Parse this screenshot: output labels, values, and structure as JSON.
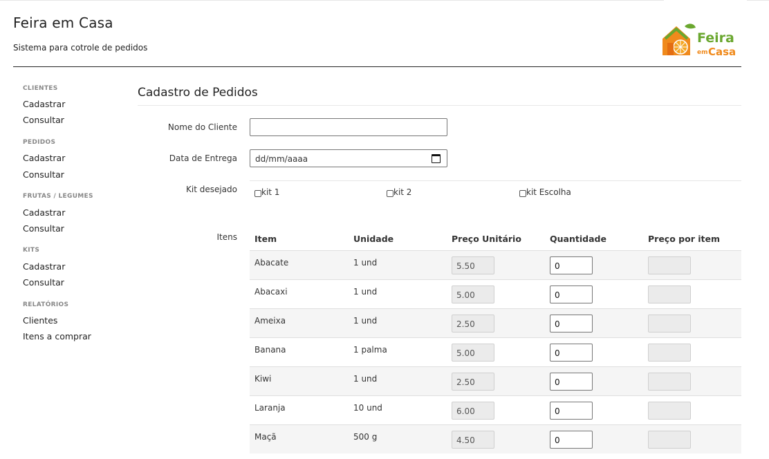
{
  "header": {
    "title": "Feira em Casa",
    "subtitle": "Sistema para cotrole de pedidos",
    "logo_text": "Feira em Casa"
  },
  "sidebar": {
    "sections": [
      {
        "title": "CLIENTES",
        "items": [
          "Cadastrar",
          "Consultar"
        ]
      },
      {
        "title": "PEDIDOS",
        "items": [
          "Cadastrar",
          "Consultar"
        ]
      },
      {
        "title": "FRUTAS / LEGUMES",
        "items": [
          "Cadastrar",
          "Consultar"
        ]
      },
      {
        "title": "KITS",
        "items": [
          "Cadastrar",
          "Consultar"
        ]
      },
      {
        "title": "RELATÓRIOS",
        "items": [
          "Clientes",
          "Itens a comprar"
        ]
      }
    ]
  },
  "form": {
    "page_title": "Cadastro de Pedidos",
    "client_label": "Nome do Cliente",
    "client_value": "",
    "date_label": "Data de Entrega",
    "date_placeholder": "dd/mm/aaaa",
    "kit_label": "Kit desejado",
    "kits": [
      "kit 1",
      "kit 2",
      "kit Escolha"
    ],
    "items_label": "Itens"
  },
  "table": {
    "columns": [
      "Item",
      "Unidade",
      "Preço Unitário",
      "Quantidade",
      "Preço por item"
    ],
    "rows": [
      {
        "item": "Abacate",
        "unit": "1 und",
        "price": "5.50",
        "qty": "0",
        "total": ""
      },
      {
        "item": "Abacaxi",
        "unit": "1 und",
        "price": "5.00",
        "qty": "0",
        "total": ""
      },
      {
        "item": "Ameixa",
        "unit": "1 und",
        "price": "2.50",
        "qty": "0",
        "total": ""
      },
      {
        "item": "Banana",
        "unit": "1 palma",
        "price": "5.00",
        "qty": "0",
        "total": ""
      },
      {
        "item": "Kiwi",
        "unit": "1 und",
        "price": "2.50",
        "qty": "0",
        "total": ""
      },
      {
        "item": "Laranja",
        "unit": "10 und",
        "price": "6.00",
        "qty": "0",
        "total": ""
      },
      {
        "item": "Maçã",
        "unit": "500 g",
        "price": "4.50",
        "qty": "0",
        "total": ""
      }
    ]
  },
  "colors": {
    "logo_green": "#6aa72f",
    "logo_orange": "#f08a1c"
  }
}
